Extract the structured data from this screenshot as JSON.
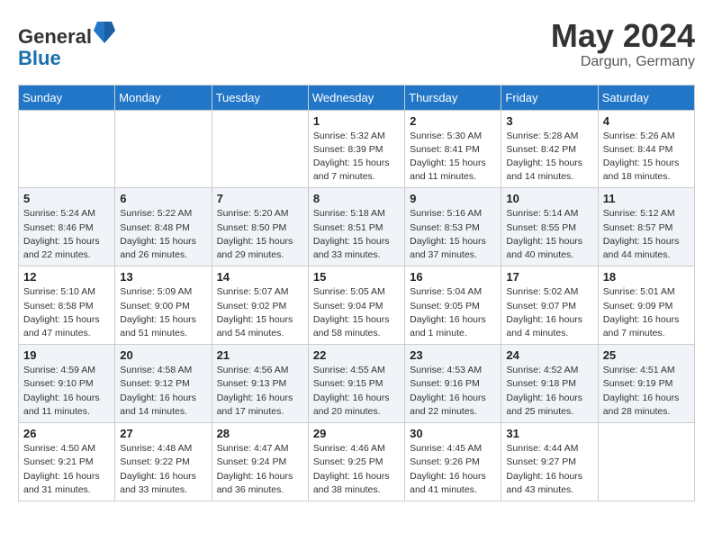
{
  "header": {
    "logo_general": "General",
    "logo_blue": "Blue",
    "month_year": "May 2024",
    "location": "Dargun, Germany"
  },
  "weekdays": [
    "Sunday",
    "Monday",
    "Tuesday",
    "Wednesday",
    "Thursday",
    "Friday",
    "Saturday"
  ],
  "weeks": [
    [
      {
        "day": "",
        "sunrise": "",
        "sunset": "",
        "daylight": ""
      },
      {
        "day": "",
        "sunrise": "",
        "sunset": "",
        "daylight": ""
      },
      {
        "day": "",
        "sunrise": "",
        "sunset": "",
        "daylight": ""
      },
      {
        "day": "1",
        "sunrise": "Sunrise: 5:32 AM",
        "sunset": "Sunset: 8:39 PM",
        "daylight": "Daylight: 15 hours and 7 minutes."
      },
      {
        "day": "2",
        "sunrise": "Sunrise: 5:30 AM",
        "sunset": "Sunset: 8:41 PM",
        "daylight": "Daylight: 15 hours and 11 minutes."
      },
      {
        "day": "3",
        "sunrise": "Sunrise: 5:28 AM",
        "sunset": "Sunset: 8:42 PM",
        "daylight": "Daylight: 15 hours and 14 minutes."
      },
      {
        "day": "4",
        "sunrise": "Sunrise: 5:26 AM",
        "sunset": "Sunset: 8:44 PM",
        "daylight": "Daylight: 15 hours and 18 minutes."
      }
    ],
    [
      {
        "day": "5",
        "sunrise": "Sunrise: 5:24 AM",
        "sunset": "Sunset: 8:46 PM",
        "daylight": "Daylight: 15 hours and 22 minutes."
      },
      {
        "day": "6",
        "sunrise": "Sunrise: 5:22 AM",
        "sunset": "Sunset: 8:48 PM",
        "daylight": "Daylight: 15 hours and 26 minutes."
      },
      {
        "day": "7",
        "sunrise": "Sunrise: 5:20 AM",
        "sunset": "Sunset: 8:50 PM",
        "daylight": "Daylight: 15 hours and 29 minutes."
      },
      {
        "day": "8",
        "sunrise": "Sunrise: 5:18 AM",
        "sunset": "Sunset: 8:51 PM",
        "daylight": "Daylight: 15 hours and 33 minutes."
      },
      {
        "day": "9",
        "sunrise": "Sunrise: 5:16 AM",
        "sunset": "Sunset: 8:53 PM",
        "daylight": "Daylight: 15 hours and 37 minutes."
      },
      {
        "day": "10",
        "sunrise": "Sunrise: 5:14 AM",
        "sunset": "Sunset: 8:55 PM",
        "daylight": "Daylight: 15 hours and 40 minutes."
      },
      {
        "day": "11",
        "sunrise": "Sunrise: 5:12 AM",
        "sunset": "Sunset: 8:57 PM",
        "daylight": "Daylight: 15 hours and 44 minutes."
      }
    ],
    [
      {
        "day": "12",
        "sunrise": "Sunrise: 5:10 AM",
        "sunset": "Sunset: 8:58 PM",
        "daylight": "Daylight: 15 hours and 47 minutes."
      },
      {
        "day": "13",
        "sunrise": "Sunrise: 5:09 AM",
        "sunset": "Sunset: 9:00 PM",
        "daylight": "Daylight: 15 hours and 51 minutes."
      },
      {
        "day": "14",
        "sunrise": "Sunrise: 5:07 AM",
        "sunset": "Sunset: 9:02 PM",
        "daylight": "Daylight: 15 hours and 54 minutes."
      },
      {
        "day": "15",
        "sunrise": "Sunrise: 5:05 AM",
        "sunset": "Sunset: 9:04 PM",
        "daylight": "Daylight: 15 hours and 58 minutes."
      },
      {
        "day": "16",
        "sunrise": "Sunrise: 5:04 AM",
        "sunset": "Sunset: 9:05 PM",
        "daylight": "Daylight: 16 hours and 1 minute."
      },
      {
        "day": "17",
        "sunrise": "Sunrise: 5:02 AM",
        "sunset": "Sunset: 9:07 PM",
        "daylight": "Daylight: 16 hours and 4 minutes."
      },
      {
        "day": "18",
        "sunrise": "Sunrise: 5:01 AM",
        "sunset": "Sunset: 9:09 PM",
        "daylight": "Daylight: 16 hours and 7 minutes."
      }
    ],
    [
      {
        "day": "19",
        "sunrise": "Sunrise: 4:59 AM",
        "sunset": "Sunset: 9:10 PM",
        "daylight": "Daylight: 16 hours and 11 minutes."
      },
      {
        "day": "20",
        "sunrise": "Sunrise: 4:58 AM",
        "sunset": "Sunset: 9:12 PM",
        "daylight": "Daylight: 16 hours and 14 minutes."
      },
      {
        "day": "21",
        "sunrise": "Sunrise: 4:56 AM",
        "sunset": "Sunset: 9:13 PM",
        "daylight": "Daylight: 16 hours and 17 minutes."
      },
      {
        "day": "22",
        "sunrise": "Sunrise: 4:55 AM",
        "sunset": "Sunset: 9:15 PM",
        "daylight": "Daylight: 16 hours and 20 minutes."
      },
      {
        "day": "23",
        "sunrise": "Sunrise: 4:53 AM",
        "sunset": "Sunset: 9:16 PM",
        "daylight": "Daylight: 16 hours and 22 minutes."
      },
      {
        "day": "24",
        "sunrise": "Sunrise: 4:52 AM",
        "sunset": "Sunset: 9:18 PM",
        "daylight": "Daylight: 16 hours and 25 minutes."
      },
      {
        "day": "25",
        "sunrise": "Sunrise: 4:51 AM",
        "sunset": "Sunset: 9:19 PM",
        "daylight": "Daylight: 16 hours and 28 minutes."
      }
    ],
    [
      {
        "day": "26",
        "sunrise": "Sunrise: 4:50 AM",
        "sunset": "Sunset: 9:21 PM",
        "daylight": "Daylight: 16 hours and 31 minutes."
      },
      {
        "day": "27",
        "sunrise": "Sunrise: 4:48 AM",
        "sunset": "Sunset: 9:22 PM",
        "daylight": "Daylight: 16 hours and 33 minutes."
      },
      {
        "day": "28",
        "sunrise": "Sunrise: 4:47 AM",
        "sunset": "Sunset: 9:24 PM",
        "daylight": "Daylight: 16 hours and 36 minutes."
      },
      {
        "day": "29",
        "sunrise": "Sunrise: 4:46 AM",
        "sunset": "Sunset: 9:25 PM",
        "daylight": "Daylight: 16 hours and 38 minutes."
      },
      {
        "day": "30",
        "sunrise": "Sunrise: 4:45 AM",
        "sunset": "Sunset: 9:26 PM",
        "daylight": "Daylight: 16 hours and 41 minutes."
      },
      {
        "day": "31",
        "sunrise": "Sunrise: 4:44 AM",
        "sunset": "Sunset: 9:27 PM",
        "daylight": "Daylight: 16 hours and 43 minutes."
      },
      {
        "day": "",
        "sunrise": "",
        "sunset": "",
        "daylight": ""
      }
    ]
  ]
}
